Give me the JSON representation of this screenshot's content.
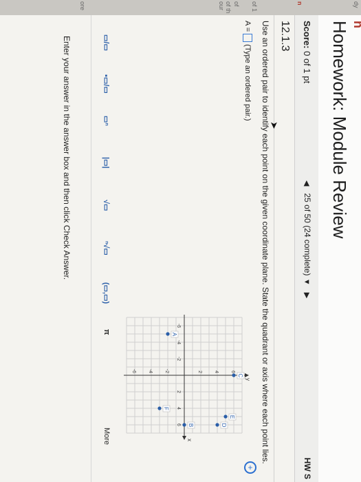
{
  "header": {
    "title": "Homework: Module Review",
    "accent_letter": "h"
  },
  "left_strip": {
    "labels": [
      "dy",
      "n",
      "of 1",
      "of",
      "of th",
      "our",
      "ore"
    ]
  },
  "scorebar": {
    "score_label": "Score:",
    "score_value": "0 of 1 pt",
    "progress": "25 of 50 (24 complete)",
    "hw_label": "HW S"
  },
  "question": {
    "number": "12.1.3",
    "instruction": "Use an ordered pair to identify each point on the given coordinate plane. State the quadrant or axis where each point lies.",
    "answer_prefix": "A =",
    "answer_hint": "(Type an ordered pair.)"
  },
  "chart_data": {
    "type": "scatter",
    "xlabel": "x",
    "ylabel": "y",
    "xlim": [
      -7,
      7
    ],
    "ylim": [
      -7,
      7
    ],
    "grid": true,
    "x_tick_labels": [
      "-6",
      "-4",
      "-2",
      "2",
      "4",
      "6"
    ],
    "y_tick_labels": [
      "-6",
      "-4",
      "-2",
      "2",
      "4",
      "6"
    ],
    "points": [
      {
        "label": "A",
        "x": -5,
        "y": -2
      },
      {
        "label": "B",
        "x": 6,
        "y": 0
      },
      {
        "label": "C",
        "x": 0,
        "y": 6
      },
      {
        "label": "D",
        "x": 6,
        "y": 4
      },
      {
        "label": "E",
        "x": 5,
        "y": 5
      },
      {
        "label": "F",
        "x": 4,
        "y": -3
      }
    ],
    "point_color": "#2a5ea8"
  },
  "toolbar": {
    "tools": [
      "fraction-icon",
      "mixed-number-icon",
      "exponent-icon",
      "absolute-value-icon",
      "sqrt-icon",
      "nth-root-icon",
      "ordered-pair-icon",
      "pi-icon"
    ],
    "more_label": "More"
  },
  "footer": {
    "text": "Enter your answer in the answer box and then click Check Answer."
  }
}
